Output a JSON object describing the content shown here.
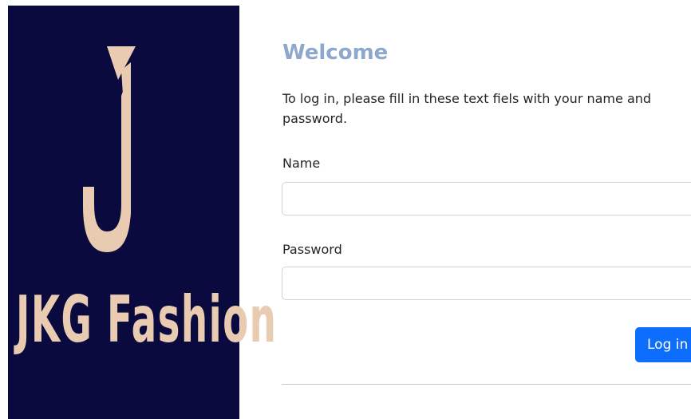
{
  "brand": {
    "name": "JKG Fashion",
    "logo_icon": "letter-j-logo",
    "background_color": "#0b0a3f",
    "logo_color": "#e8cbb0"
  },
  "login": {
    "title": "Welcome",
    "intro": "To log in, please fill in these text fiels with your name and password.",
    "name_label": "Name",
    "name_value": "",
    "password_label": "Password",
    "password_value": "",
    "submit_label": "Log in",
    "title_color": "#8ea7cc",
    "button_color": "#0d6efd"
  }
}
